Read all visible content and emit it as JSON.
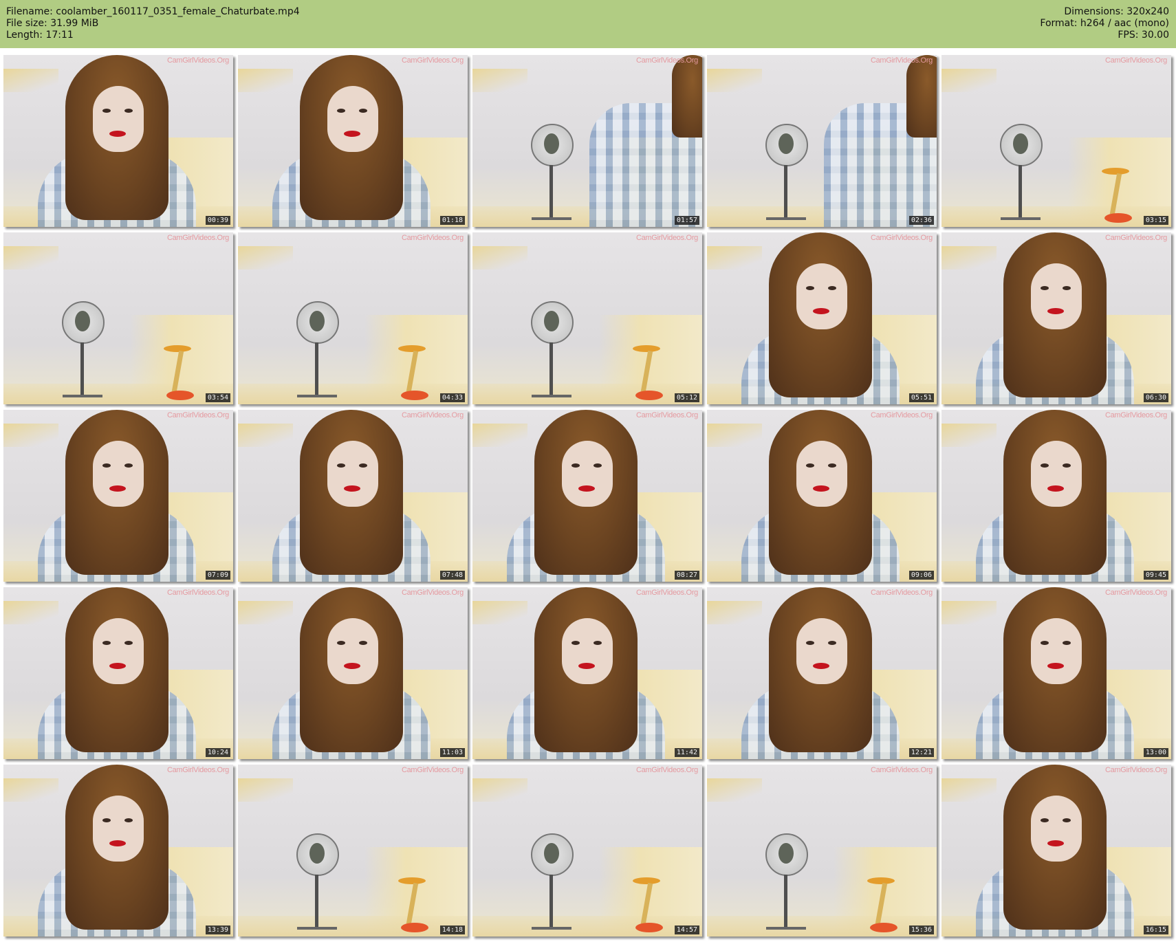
{
  "header": {
    "filename_line": "Filename: coolamber_160117_0351_female_Chaturbate.mp4",
    "filesize_line": "File size: 31.99 MiB",
    "length_line": "Length: 17:11",
    "dimensions_line": "Dimensions: 320x240",
    "format_line": "Format: h264 / aac (mono)",
    "fps_line": "FPS: 30.00",
    "background_color": "#b1cc83"
  },
  "thumbnails": [
    {
      "timestamp": "00:39",
      "watermark": "CamGirlVideos.Org",
      "scene": "person"
    },
    {
      "timestamp": "01:18",
      "watermark": "CamGirlVideos.Org",
      "scene": "person"
    },
    {
      "timestamp": "01:57",
      "watermark": "CamGirlVideos.Org",
      "scene": "fan"
    },
    {
      "timestamp": "02:36",
      "watermark": "CamGirlVideos.Org",
      "scene": "fan"
    },
    {
      "timestamp": "03:15",
      "watermark": "CamGirlVideos.Org",
      "scene": "fan-stool"
    },
    {
      "timestamp": "03:54",
      "watermark": "CamGirlVideos.Org",
      "scene": "fan-stool"
    },
    {
      "timestamp": "04:33",
      "watermark": "CamGirlVideos.Org",
      "scene": "fan-stool"
    },
    {
      "timestamp": "05:12",
      "watermark": "CamGirlVideos.Org",
      "scene": "fan-stool"
    },
    {
      "timestamp": "05:51",
      "watermark": "CamGirlVideos.Org",
      "scene": "person"
    },
    {
      "timestamp": "06:30",
      "watermark": "CamGirlVideos.Org",
      "scene": "person"
    },
    {
      "timestamp": "07:09",
      "watermark": "CamGirlVideos.Org",
      "scene": "person"
    },
    {
      "timestamp": "07:48",
      "watermark": "CamGirlVideos.Org",
      "scene": "person"
    },
    {
      "timestamp": "08:27",
      "watermark": "CamGirlVideos.Org",
      "scene": "person"
    },
    {
      "timestamp": "09:06",
      "watermark": "CamGirlVideos.Org",
      "scene": "person"
    },
    {
      "timestamp": "09:45",
      "watermark": "CamGirlVideos.Org",
      "scene": "person"
    },
    {
      "timestamp": "10:24",
      "watermark": "CamGirlVideos.Org",
      "scene": "person"
    },
    {
      "timestamp": "11:03",
      "watermark": "CamGirlVideos.Org",
      "scene": "person"
    },
    {
      "timestamp": "11:42",
      "watermark": "CamGirlVideos.Org",
      "scene": "person"
    },
    {
      "timestamp": "12:21",
      "watermark": "CamGirlVideos.Org",
      "scene": "person"
    },
    {
      "timestamp": "13:00",
      "watermark": "CamGirlVideos.Org",
      "scene": "person"
    },
    {
      "timestamp": "13:39",
      "watermark": "CamGirlVideos.Org",
      "scene": "person"
    },
    {
      "timestamp": "14:18",
      "watermark": "CamGirlVideos.Org",
      "scene": "fan-stool"
    },
    {
      "timestamp": "14:57",
      "watermark": "CamGirlVideos.Org",
      "scene": "fan-stool"
    },
    {
      "timestamp": "15:36",
      "watermark": "CamGirlVideos.Org",
      "scene": "fan-stool"
    },
    {
      "timestamp": "16:15",
      "watermark": "CamGirlVideos.Org",
      "scene": "person"
    }
  ]
}
